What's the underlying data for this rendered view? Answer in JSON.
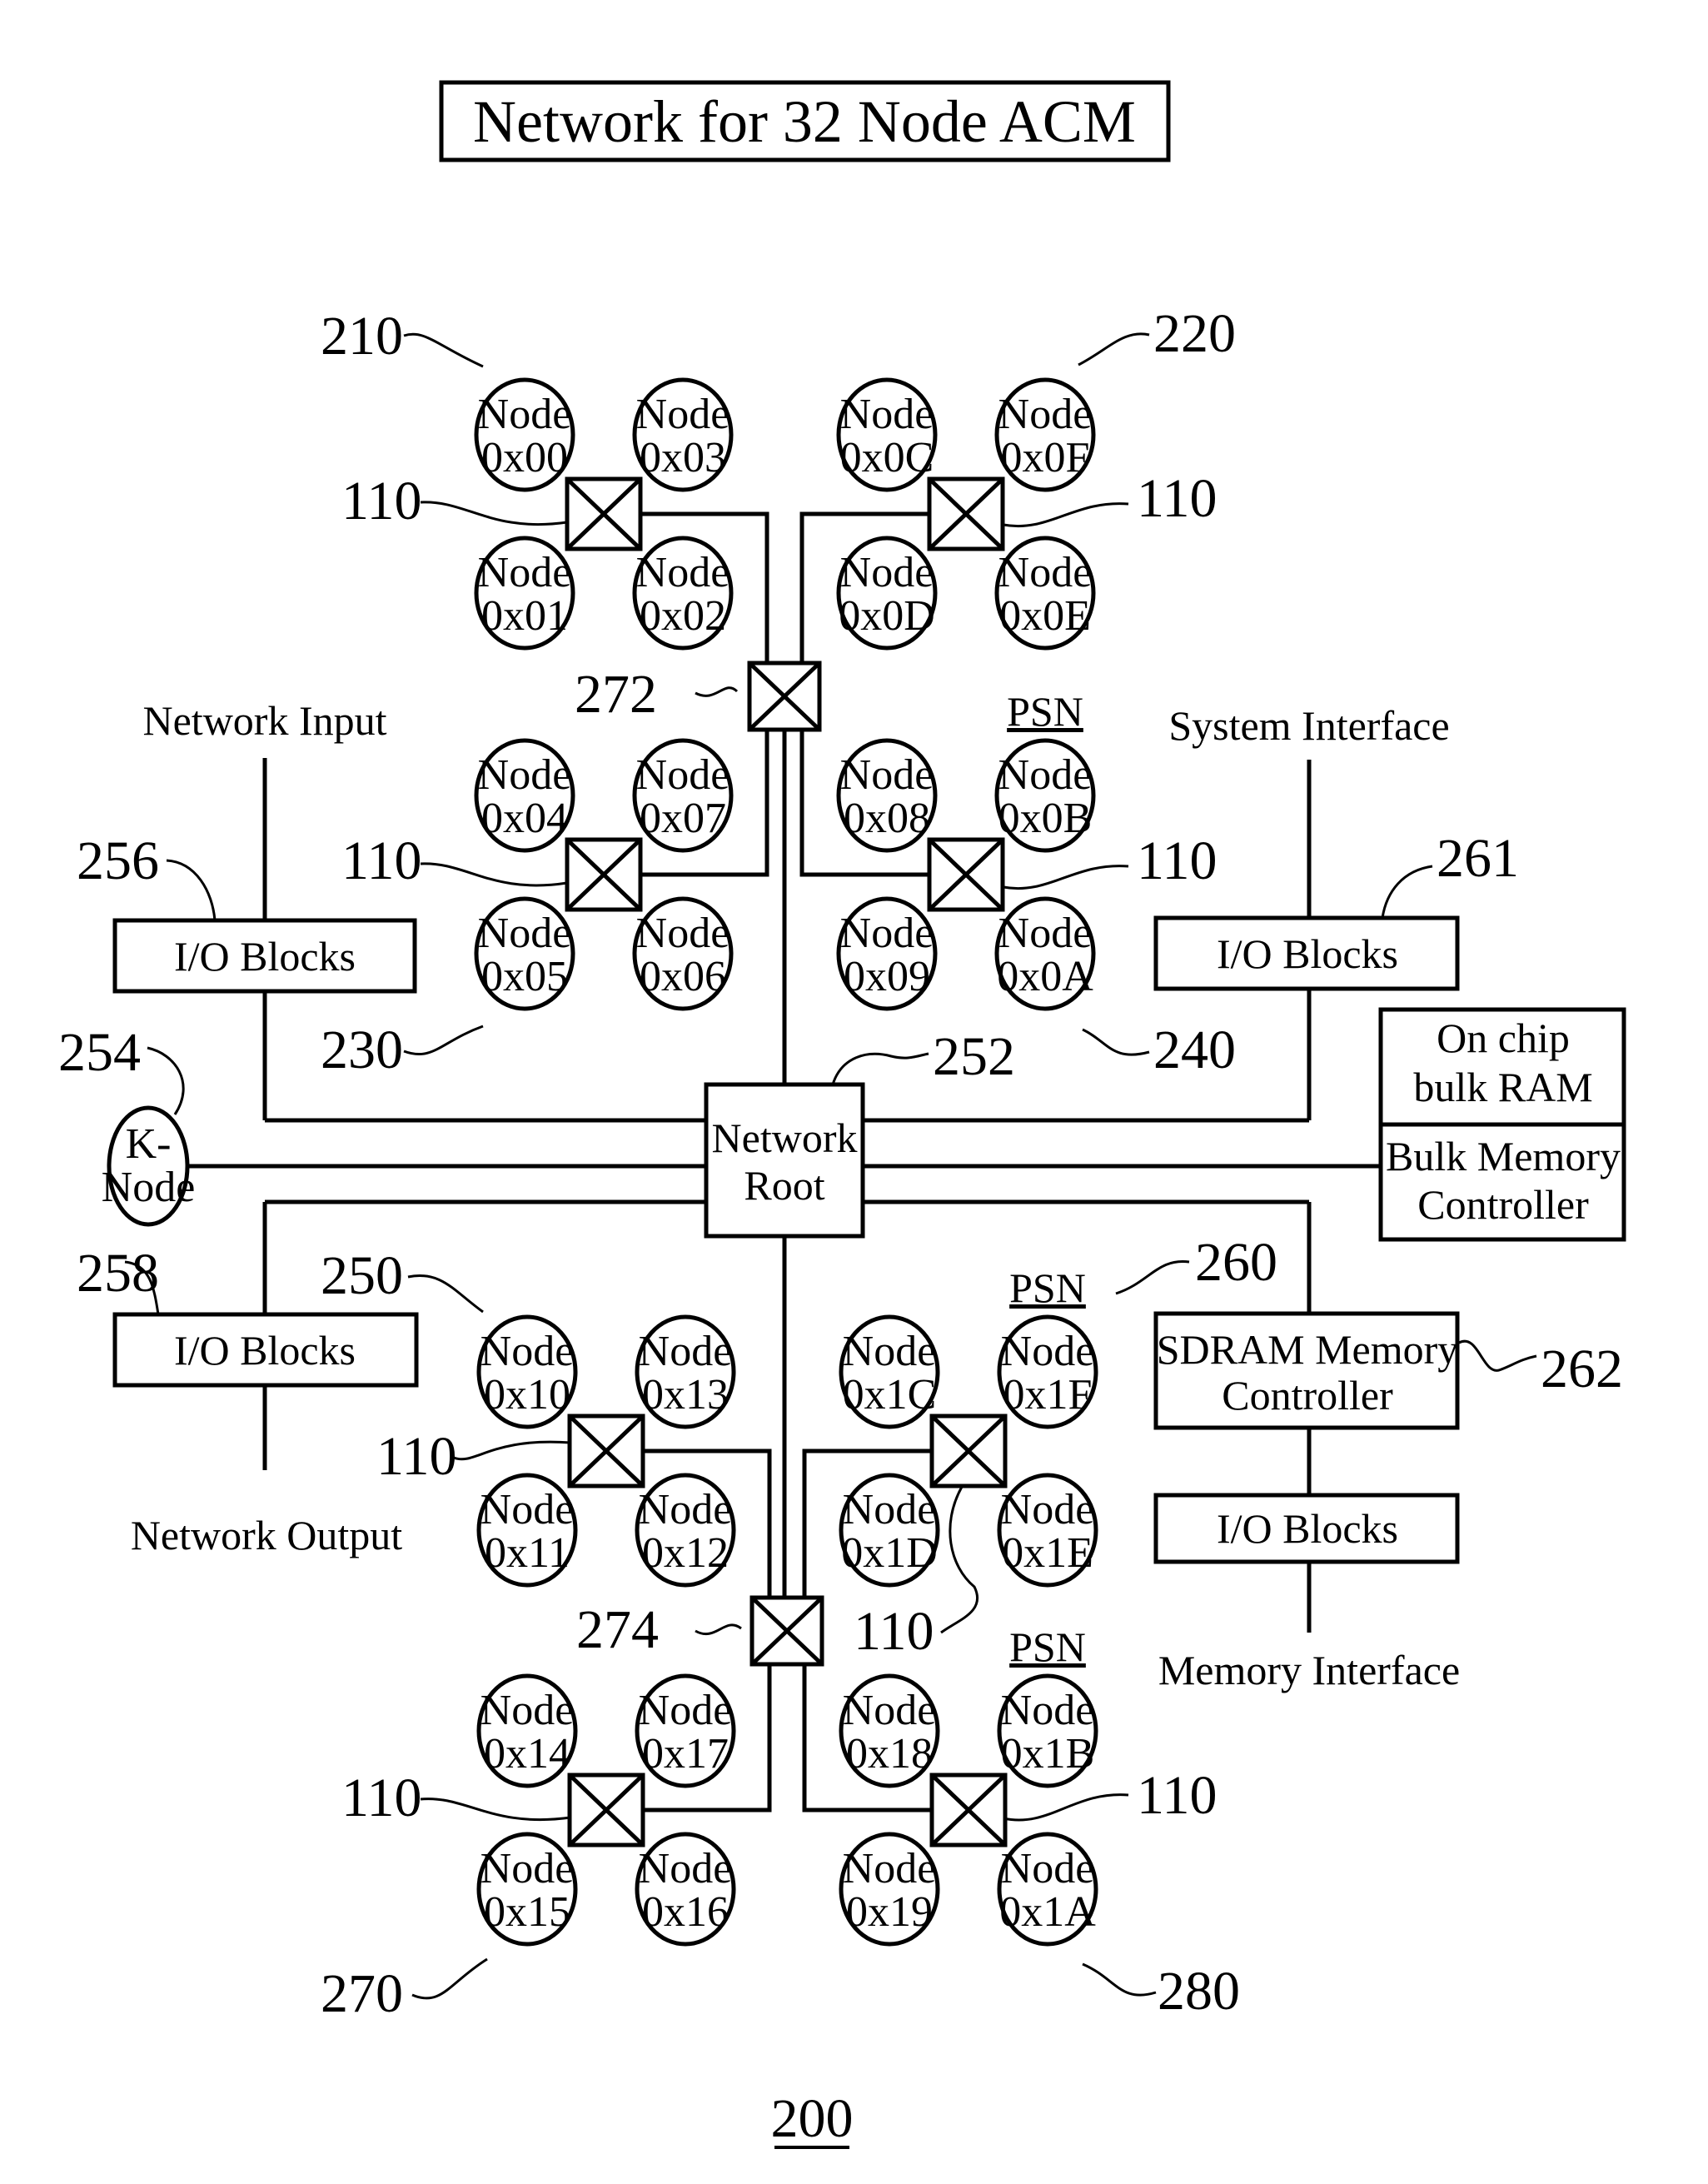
{
  "title": "Network for 32 Node ACM",
  "figure_number": "200",
  "node_word": "Node",
  "quadrants": [
    {
      "ref": "210",
      "nodes": [
        "0x00",
        "0x03",
        "0x01",
        "0x02"
      ],
      "switch_ref": "110",
      "psn": ""
    },
    {
      "ref": "220",
      "nodes": [
        "0x0C",
        "0x0F",
        "0x0D",
        "0x0E"
      ],
      "switch_ref": "110",
      "psn": ""
    },
    {
      "ref": "230",
      "nodes": [
        "0x04",
        "0x07",
        "0x05",
        "0x06"
      ],
      "switch_ref": "110",
      "psn": ""
    },
    {
      "ref": "240",
      "nodes": [
        "0x08",
        "0x0B",
        "0x09",
        "0x0A"
      ],
      "switch_ref": "110",
      "psn": "PSN"
    },
    {
      "ref": "250",
      "nodes": [
        "0x10",
        "0x13",
        "0x11",
        "0x12"
      ],
      "switch_ref": "110",
      "psn": ""
    },
    {
      "ref": "260",
      "nodes": [
        "0x1C",
        "0x1F",
        "0x1D",
        "0x1E"
      ],
      "switch_ref": "110",
      "psn": "PSN"
    },
    {
      "ref": "270",
      "nodes": [
        "0x14",
        "0x17",
        "0x15",
        "0x16"
      ],
      "switch_ref": "110",
      "psn": ""
    },
    {
      "ref": "280",
      "nodes": [
        "0x18",
        "0x1B",
        "0x19",
        "0x1A"
      ],
      "switch_ref": "110",
      "psn": "PSN"
    }
  ],
  "switches": {
    "upper": {
      "ref": "272"
    },
    "lower": {
      "ref": "274"
    }
  },
  "network_root": {
    "ref": "252",
    "line1": "Network",
    "line2": "Root"
  },
  "k_node": {
    "ref": "254",
    "line1": "K-",
    "line2": "Node"
  },
  "io_blocks": {
    "network_input": {
      "ref": "256",
      "label": "I/O Blocks",
      "port_label": "Network Input"
    },
    "network_output": {
      "ref": "258",
      "label": "I/O Blocks",
      "port_label": "Network Output"
    },
    "system_interface": {
      "ref": "261",
      "label": "I/O Blocks",
      "port_label": "System Interface"
    },
    "memory_interface": {
      "ref": "",
      "label": "I/O Blocks",
      "port_label": "Memory Interface"
    }
  },
  "bulk_ram": {
    "line1": "On chip",
    "line2": "bulk RAM",
    "ctrl_line1": "Bulk Memory",
    "ctrl_line2": "Controller"
  },
  "sdram": {
    "ref": "262",
    "line1": "SDRAM Memory",
    "line2": "Controller"
  }
}
